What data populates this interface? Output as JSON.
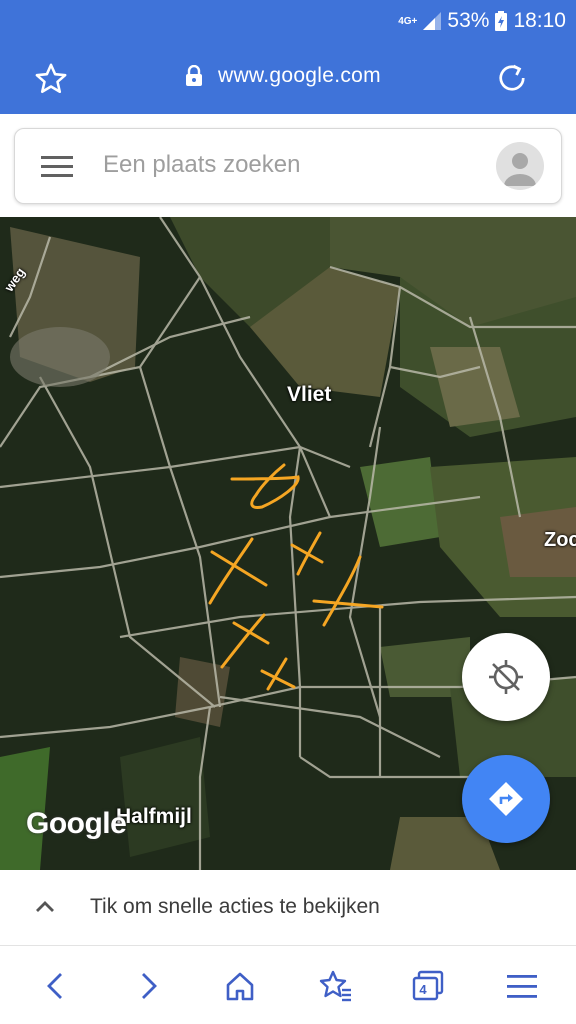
{
  "status_bar": {
    "network": "4G+",
    "battery": "53%",
    "time": "18:10"
  },
  "browser": {
    "url": "www.google.com",
    "star_icon": "star-outline-icon",
    "reload_icon": "reload-icon"
  },
  "search": {
    "placeholder": "Een plaats zoeken",
    "menu_icon": "hamburger-menu-icon",
    "avatar_icon": "account-avatar-icon"
  },
  "map": {
    "labels": {
      "vliet": "Vliet",
      "zoc": "Zoc",
      "halfmijl": "Halfmijl",
      "weg": "weg"
    },
    "logo": "Google",
    "annotation_color": "#f5a623",
    "locate_icon": "location-disabled-icon",
    "directions_icon": "directions-icon"
  },
  "quick_actions": {
    "label": "Tik om snelle acties te bekijken"
  },
  "bottom_nav": {
    "tab_count": "4",
    "icons": [
      "back-icon",
      "forward-icon",
      "home-icon",
      "bookmarks-icon",
      "tabs-icon",
      "menu-icon"
    ]
  },
  "colors": {
    "top_bar": "#3f73d9",
    "nav_icons": "#3f5fc6",
    "directions_button": "#4285f4"
  }
}
